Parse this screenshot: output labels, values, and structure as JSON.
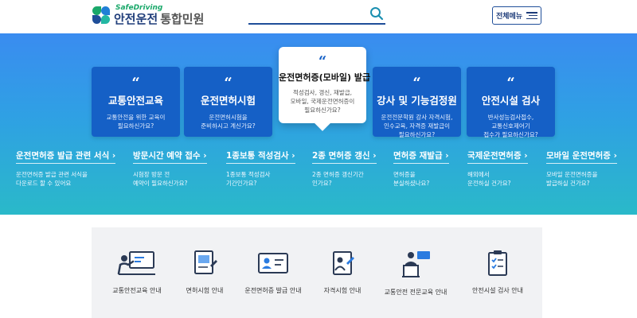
{
  "header": {
    "logo_en": "SafeDriving",
    "logo_main": "안전운전",
    "logo_sub": "통합민원",
    "search_placeholder": "",
    "menu_label": "전체메뉴"
  },
  "colors": {
    "primary": "#1560c6",
    "accent": "#1f4e99",
    "green": "#1aa86a"
  },
  "cards": [
    {
      "title": "교통안전교육",
      "desc": "교통안전을 위한 교육이\n필요하신가요?"
    },
    {
      "title": "운전면허시험",
      "desc": "운전면허시험을\n준비하시고 계신가요?"
    },
    {
      "title": "운전면허증(모바일) 발급",
      "desc": "적성검사, 갱신, 재발급,\n모바일, 국제운전면허증이\n필요하신가요?"
    },
    {
      "title": "강사 및 기능검정원",
      "desc": "운전전문학원 강사 자격시험,\n인수교육, 자격증 재발급이\n필요하신가요?"
    },
    {
      "title": "안전시설 검사",
      "desc": "반사성능검사접수,\n교통신호제어기\n접수가 필요하신가요?"
    }
  ],
  "links": [
    {
      "title": "운전면허증 발급 관련 서식",
      "desc": "운전면허증 발급 관련 서식을\n다운로드 할 수 있어요"
    },
    {
      "title": "방문시간 예약 접수",
      "desc": "시험장 방문 전\n예약이 필요하신가요?"
    },
    {
      "title": "1종보통 적성검사",
      "desc": "1종보통 적성검사\n기간인가요?"
    },
    {
      "title": "2종 면허증 갱신",
      "desc": "2종 면허증 갱신기간\n인가요?"
    },
    {
      "title": "면허증 재발급",
      "desc": "면허증을\n분실하셨나요?"
    },
    {
      "title": "국제운전면허증",
      "desc": "해외에서\n운전하실 건가요?"
    },
    {
      "title": "모바일 운전면허증",
      "desc": "모바일 운전면허증을\n발급하실 건가요?"
    }
  ],
  "services": [
    {
      "label": "교통안전교육 안내",
      "icon": "classroom-icon"
    },
    {
      "label": "면허시험 안내",
      "icon": "license-exam-icon"
    },
    {
      "label": "운전면허증 발급 안내",
      "icon": "license-card-icon"
    },
    {
      "label": "자격시험 안내",
      "icon": "qualification-doc-icon"
    },
    {
      "label": "교통안전 전문교육 안내",
      "icon": "lecture-podium-icon"
    },
    {
      "label": "안전시설 검사 안내",
      "icon": "checklist-clipboard-icon"
    }
  ]
}
